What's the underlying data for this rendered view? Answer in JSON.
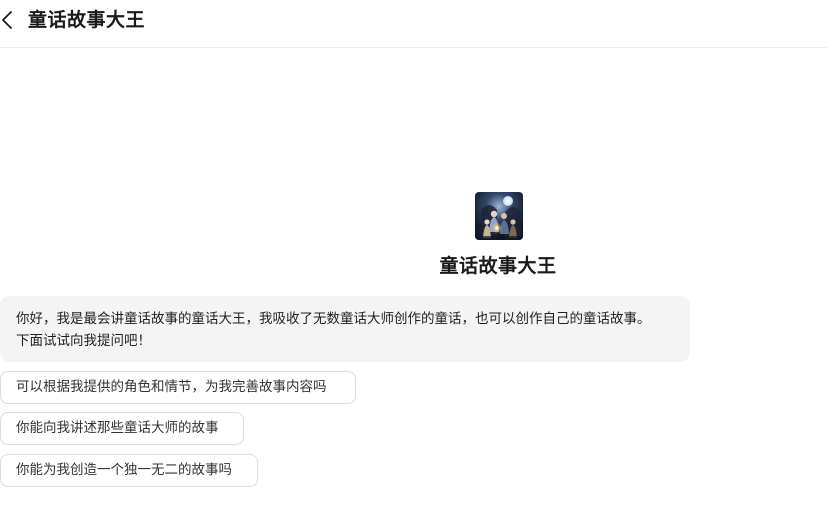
{
  "header": {
    "title": "童话故事大王",
    "back_icon": "chevron-left-icon"
  },
  "bot": {
    "name": "童话故事大王",
    "avatar_icon": "fairy-tale-avatar-icon"
  },
  "greeting": {
    "line1": "你好，我是最会讲童话故事的童话大王，我吸收了无数童话大师创作的童话，也可以创作自己的童话故事。",
    "line2": "下面试试向我提问吧！"
  },
  "suggestions": [
    "可以根据我提供的角色和情节，为我完善故事内容吗",
    "你能向我讲述那些童话大师的故事",
    "你能为我创造一个独一无二的故事吗"
  ],
  "colors": {
    "bubble_bg": "#f4f4f5",
    "chip_border": "#dcdcdf",
    "text": "#1f1f1f"
  }
}
